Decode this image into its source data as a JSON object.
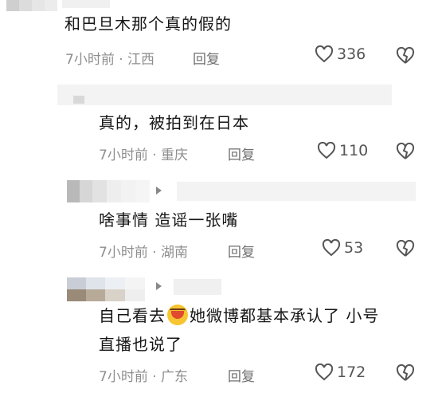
{
  "comments": [
    {
      "text": "和巴旦木那个真的假的",
      "time": "7小时前",
      "sep": "·",
      "location": "江西",
      "reply_label": "回复",
      "likes": "336"
    },
    {
      "text": "真的，被拍到在日本",
      "time": "7小时前",
      "sep": "·",
      "location": "重庆",
      "reply_label": "回复",
      "likes": "110"
    },
    {
      "text": "啥事情 造谣一张嘴",
      "time": "7小时前",
      "sep": "·",
      "location": "湖南",
      "reply_label": "回复",
      "likes": "53"
    },
    {
      "text_before_emoji": "自己看去",
      "emoji": "laughing-crying-emoji",
      "text_after_emoji": "她微博都基本承认了 小号",
      "text_line2": "直播也说了",
      "time": "7小时前",
      "sep": "·",
      "location": "广东",
      "reply_label": "回复",
      "likes": "172"
    }
  ],
  "icons": {
    "like": "heart-outline-icon",
    "dislike": "broken-heart-icon",
    "reply_arrow": "reply-arrow-icon"
  },
  "colors": {
    "text": "#161616",
    "meta": "#8e8e8e",
    "icon": "#555555"
  }
}
